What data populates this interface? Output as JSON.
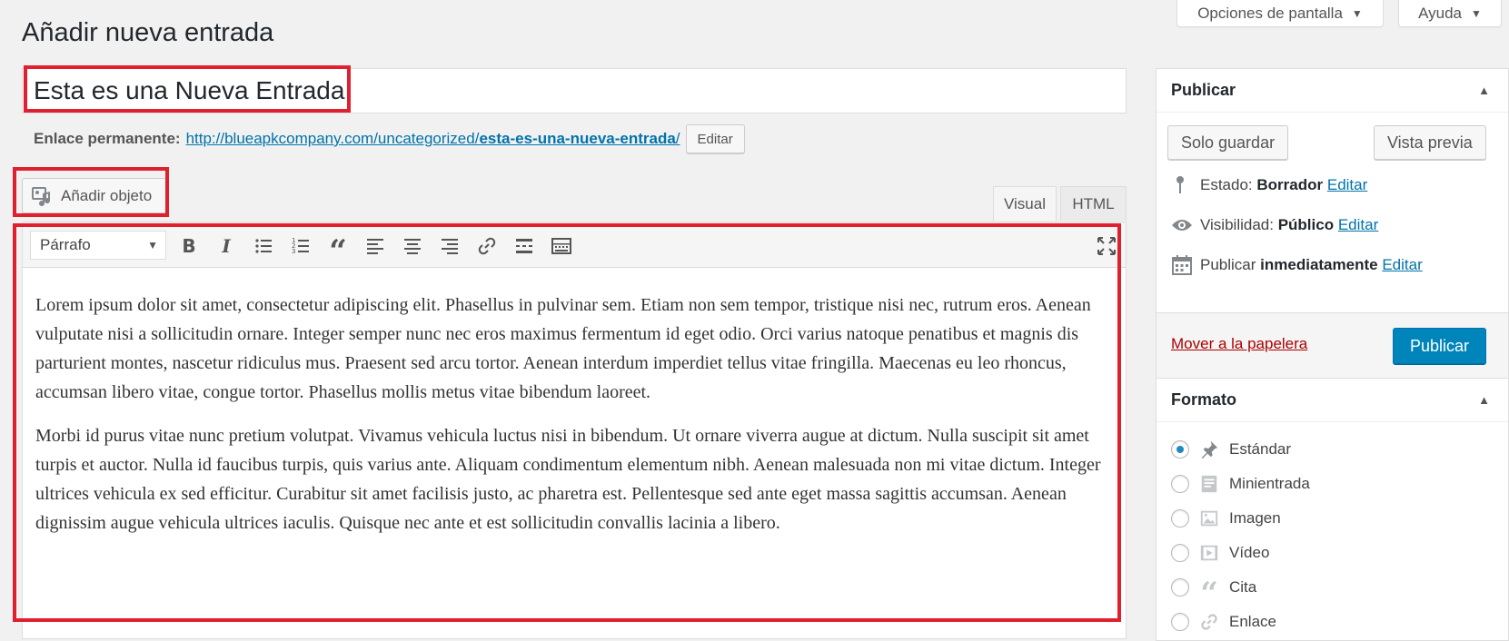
{
  "header": {
    "screen_options": "Opciones de pantalla",
    "help": "Ayuda"
  },
  "page_title": "Añadir nueva entrada",
  "post": {
    "title": "Esta es una Nueva Entrada",
    "permalink_label": "Enlace permanente:",
    "permalink_base": "http://blueарkcompany.com/uncategorized/",
    "permalink_slug": "esta-es-una-nueva-entrada",
    "permalink_trail": "/",
    "edit_label": "Editar"
  },
  "media": {
    "add_label": "Añadir objeto"
  },
  "editor": {
    "tabs": [
      {
        "label": "Visual"
      },
      {
        "label": "HTML"
      }
    ],
    "format_value": "Párrafo",
    "paragraphs": [
      "Lorem ipsum dolor sit amet, consectetur adipiscing elit. Phasellus in pulvinar sem. Etiam non sem tempor, tristique nisi nec, rutrum eros. Aenean vulputate nisi a sollicitudin ornare. Integer semper nunc nec eros maximus fermentum id eget odio. Orci varius natoque penatibus et magnis dis parturient montes, nascetur ridiculus mus. Praesent sed arcu tortor. Aenean interdum imperdiet tellus vitae fringilla. Maecenas eu leo rhoncus, accumsan libero vitae, congue tortor. Phasellus mollis metus vitae bibendum laoreet.",
      "Morbi id purus vitae nunc pretium volutpat. Vivamus vehicula luctus nisi in bibendum. Ut ornare viverra augue at dictum. Nulla suscipit sit amet turpis et auctor. Nulla id faucibus turpis, quis varius ante. Aliquam condimentum elementum nibh. Aenean malesuada non mi vitae dictum. Integer ultrices vehicula ex sed efficitur. Curabitur sit amet facilisis justo, ac pharetra est. Pellentesque sed ante eget massa sagittis accumsan. Aenean dignissim augue vehicula ultrices iaculis. Quisque nec ante et est sollicitudin convallis lacinia a libero."
    ]
  },
  "publish": {
    "title": "Publicar",
    "save_draft": "Solo guardar",
    "preview": "Vista previa",
    "status_label": "Estado:",
    "status_value": "Borrador",
    "visibility_label": "Visibilidad:",
    "visibility_value": "Público",
    "publish_label": "Publicar",
    "publish_value": "inmediatamente",
    "edit": "Editar",
    "trash": "Mover a la papelera",
    "publish_button": "Publicar"
  },
  "format": {
    "title": "Formato",
    "options": [
      {
        "label": "Estándar",
        "icon": "pin-icon",
        "checked": true
      },
      {
        "label": "Minientrada",
        "icon": "aside-icon",
        "checked": false
      },
      {
        "label": "Imagen",
        "icon": "image-icon",
        "checked": false
      },
      {
        "label": "Vídeo",
        "icon": "video-icon",
        "checked": false
      },
      {
        "label": "Cita",
        "icon": "quote-icon",
        "checked": false
      },
      {
        "label": "Enlace",
        "icon": "link-icon",
        "checked": false
      }
    ]
  },
  "colors": {
    "accent": "#0085ba",
    "link": "#0073aa",
    "trash": "#a00",
    "highlight": "#e0202e"
  }
}
